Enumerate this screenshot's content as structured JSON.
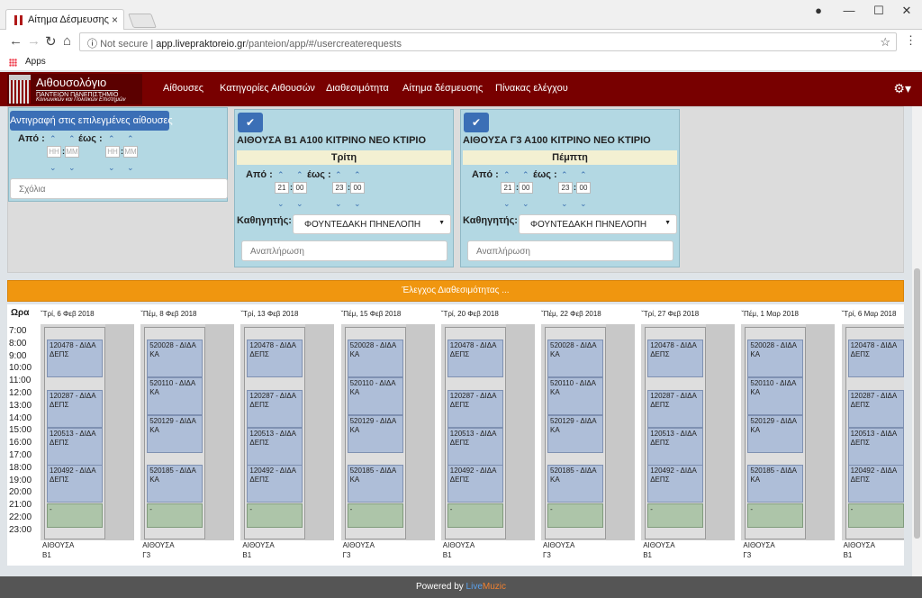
{
  "browser": {
    "tab_title": "Αίτημα Δέσμευσης",
    "tab_close": "×",
    "url_prefix": "Not secure",
    "url_host": "app.livepraktoreio.gr",
    "url_path": "/panteion/app/#/usercreaterequests",
    "bookmark_apps": "Apps",
    "icons": [
      "back-icon",
      "forward-icon",
      "reload-icon",
      "home-icon",
      "info-icon",
      "star-icon",
      "menu-icon",
      "account-icon",
      "minimize-icon",
      "maximize-icon",
      "close-icon"
    ]
  },
  "navbar": {
    "brand": "Αιθουσολόγιο",
    "brand_sub1": "ΠΑΝΤΕΙΟΝ ΠΑΝΕΠΙΣΤΗΜΙΟ",
    "brand_sub2": "Κοινωνικών και Πολιτικών Επιστημών",
    "links": [
      "Αίθουσες",
      "Κατηγορίες Αιθουσών",
      "Διαθεσιμότητα",
      "Αίτημα δέσμευσης",
      "Πίνακας ελέγχου"
    ],
    "settings_icon": "gear-icon",
    "color": "#780000"
  },
  "copy_panel": {
    "button": "Αντιγραφή στις επιλεγμένες αίθουσες",
    "from_label": "Από :",
    "to_label": "έως :",
    "hh": "HH",
    "mm": "MM",
    "comments_placeholder": "Σχόλια"
  },
  "rooms": [
    {
      "title": "ΑΙΘΟΥΣΑ Β1 Α100 ΚΙΤΡΙΝΟ ΝΕΟ ΚΤΙΡΙΟ",
      "day": "Τρίτη",
      "from_label": "Από :",
      "to_label": "έως :",
      "from_h": "21",
      "from_m": "00",
      "to_h": "23",
      "to_m": "00",
      "prof_label": "Καθηγητής:",
      "prof": "ΦΟΥΝΤΕΔΑΚΗ ΠΗΝΕΛΟΠΗ",
      "note_placeholder": "Αναπλήρωση"
    },
    {
      "title": "ΑΙΘΟΥΣΑ Γ3 Α100 ΚΙΤΡΙΝΟ ΝΕΟ ΚΤΙΡΙΟ",
      "day": "Πέμπτη",
      "from_label": "Από :",
      "to_label": "έως :",
      "from_h": "21",
      "from_m": "00",
      "to_h": "23",
      "to_m": "00",
      "prof_label": "Καθηγητής:",
      "prof": "ΦΟΥΝΤΕΔΑΚΗ ΠΗΝΕΛΟΠΗ",
      "note_placeholder": "Αναπλήρωση"
    }
  ],
  "availability_button": "Έλεγχος Διαθεσιμότητας ...",
  "schedule": {
    "hours_title": "Ωρα",
    "hours": [
      "7:00",
      "8:00",
      "9:00",
      "10:00",
      "11:00",
      "12:00",
      "13:00",
      "14:00",
      "15:00",
      "16:00",
      "17:00",
      "18:00",
      "19:00",
      "20:00",
      "21:00",
      "22:00",
      "23:00"
    ],
    "columns": [
      {
        "date": "Τρί, 6 Φεβ 2018",
        "room": "ΑΙΘΟΥΣΑ",
        "code": "Β1",
        "events": [
          [
            "120478 - ΔΙΔΑ",
            "ΔΕΠΣ"
          ],
          [
            "120287 - ΔΙΔΑ",
            "ΔΕΠΣ"
          ],
          [
            "120513 - ΔΙΔΑ",
            "ΔΕΠΣ"
          ],
          [
            "120492 - ΔΙΔΑ",
            "ΔΕΠΣ"
          ],
          [
            "-",
            ""
          ]
        ]
      },
      {
        "date": "Πέμ, 8 Φεβ 2018",
        "room": "ΑΙΘΟΥΣΑ",
        "code": "Γ3",
        "events": [
          [
            "520028 - ΔΙΔΑ",
            "ΚΑ"
          ],
          [
            "520110 - ΔΙΔΑ",
            "ΚΑ"
          ],
          [
            "520129 - ΔΙΔΑ",
            "ΚΑ"
          ],
          [
            "520185 - ΔΙΔΑ",
            "ΚΑ"
          ],
          [
            "-",
            ""
          ]
        ]
      },
      {
        "date": "Τρί, 13 Φεβ 2018",
        "room": "ΑΙΘΟΥΣΑ",
        "code": "Β1",
        "events": [
          [
            "120478 - ΔΙΔΑ",
            "ΔΕΠΣ"
          ],
          [
            "120287 - ΔΙΔΑ",
            "ΔΕΠΣ"
          ],
          [
            "120513 - ΔΙΔΑ",
            "ΔΕΠΣ"
          ],
          [
            "120492 - ΔΙΔΑ",
            "ΔΕΠΣ"
          ],
          [
            "-",
            ""
          ]
        ]
      },
      {
        "date": "Πέμ, 15 Φεβ 2018",
        "room": "ΑΙΘΟΥΣΑ",
        "code": "Γ3",
        "events": [
          [
            "520028 - ΔΙΔΑ",
            "ΚΑ"
          ],
          [
            "520110 - ΔΙΔΑ",
            "ΚΑ"
          ],
          [
            "520129 - ΔΙΔΑ",
            "ΚΑ"
          ],
          [
            "520185 - ΔΙΔΑ",
            "ΚΑ"
          ],
          [
            "-",
            ""
          ]
        ]
      },
      {
        "date": "Τρί, 20 Φεβ 2018",
        "room": "ΑΙΘΟΥΣΑ",
        "code": "Β1",
        "events": [
          [
            "120478 - ΔΙΔΑ",
            "ΔΕΠΣ"
          ],
          [
            "120287 - ΔΙΔΑ",
            "ΔΕΠΣ"
          ],
          [
            "120513 - ΔΙΔΑ",
            "ΔΕΠΣ"
          ],
          [
            "120492 - ΔΙΔΑ",
            "ΔΕΠΣ"
          ],
          [
            "-",
            ""
          ]
        ]
      },
      {
        "date": "Πέμ, 22 Φεβ 2018",
        "room": "ΑΙΘΟΥΣΑ",
        "code": "Γ3",
        "events": [
          [
            "520028 - ΔΙΔΑ",
            "ΚΑ"
          ],
          [
            "520110 - ΔΙΔΑ",
            "ΚΑ"
          ],
          [
            "520129 - ΔΙΔΑ",
            "ΚΑ"
          ],
          [
            "520185 - ΔΙΔΑ",
            "ΚΑ"
          ],
          [
            "-",
            ""
          ]
        ]
      },
      {
        "date": "Τρί, 27 Φεβ 2018",
        "room": "ΑΙΘΟΥΣΑ",
        "code": "Β1",
        "events": [
          [
            "120478 - ΔΙΔΑ",
            "ΔΕΠΣ"
          ],
          [
            "120287 - ΔΙΔΑ",
            "ΔΕΠΣ"
          ],
          [
            "120513 - ΔΙΔΑ",
            "ΔΕΠΣ"
          ],
          [
            "120492 - ΔΙΔΑ",
            "ΔΕΠΣ"
          ],
          [
            "-",
            ""
          ]
        ]
      },
      {
        "date": "Πέμ, 1 Μαρ 2018",
        "room": "ΑΙΘΟΥΣΑ",
        "code": "Γ3",
        "events": [
          [
            "520028 - ΔΙΔΑ",
            "ΚΑ"
          ],
          [
            "520110 - ΔΙΔΑ",
            "ΚΑ"
          ],
          [
            "520129 - ΔΙΔΑ",
            "ΚΑ"
          ],
          [
            "520185 - ΔΙΔΑ",
            "ΚΑ"
          ],
          [
            "-",
            ""
          ]
        ]
      },
      {
        "date": "Τρί, 6 Μαρ 2018",
        "room": "ΑΙΘΟΥΣΑ",
        "code": "Β1",
        "events": [
          [
            "120478 - ΔΙΔΑ",
            "ΔΕΠΣ"
          ],
          [
            "120287 - ΔΙΔΑ",
            "ΔΕΠΣ"
          ],
          [
            "120513 - ΔΙΔΑ",
            "ΔΕΠΣ"
          ],
          [
            "120492 - ΔΙΔΑ",
            "ΔΕΠΣ"
          ],
          [
            "-",
            ""
          ]
        ]
      }
    ]
  },
  "footer": {
    "prefix": "Powered by",
    "brand1": "Live",
    "brand2": "Muzic"
  },
  "colors": {
    "accent_blue": "#3b6fb6",
    "panel_blue": "#b3d8e3",
    "orange": "#f0960f",
    "event_blue": "#aebed8",
    "event_green": "#adc5a9"
  }
}
